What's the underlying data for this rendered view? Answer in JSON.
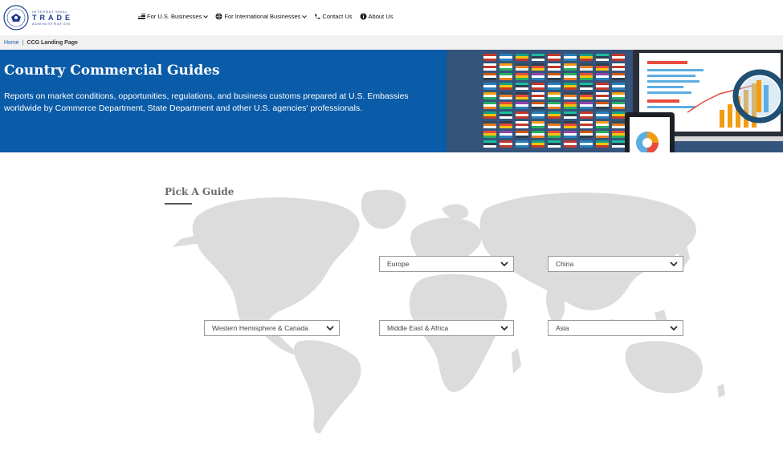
{
  "header": {
    "logo": {
      "line1": "INTERNATIONAL",
      "line2": "TRADE",
      "line3": "ADMINISTRATION"
    },
    "nav": [
      {
        "label": "For U.S. Businesses",
        "icon": "flag-icon",
        "has_dropdown": true
      },
      {
        "label": "For International Businesses",
        "icon": "globe-icon",
        "has_dropdown": true
      },
      {
        "label": "Contact Us",
        "icon": "phone-icon",
        "has_dropdown": false
      },
      {
        "label": "About Us",
        "icon": "info-icon",
        "has_dropdown": false
      }
    ]
  },
  "breadcrumb": {
    "home": "Home",
    "separator": "|",
    "current": "CCG Landing Page"
  },
  "hero": {
    "title": "Country Commercial Guides",
    "description": "Reports on market conditions, opportunities, regulations, and business customs prepared at U.S. Embassies worldwide by Commerce Department, State Department and other U.S. agencies' professionals."
  },
  "guide": {
    "title": "Pick A Guide",
    "regions": [
      {
        "label": "Europe"
      },
      {
        "label": "China"
      },
      {
        "label": "Western Hemisphere & Canada"
      },
      {
        "label": "Middle East & Africa"
      },
      {
        "label": "Asia"
      }
    ]
  },
  "colors": {
    "brand_blue": "#0a5ba8",
    "link_blue": "#1e5aa8",
    "map_gray": "#dcdcdc",
    "breadcrumb_bg": "#f1f1f1"
  }
}
